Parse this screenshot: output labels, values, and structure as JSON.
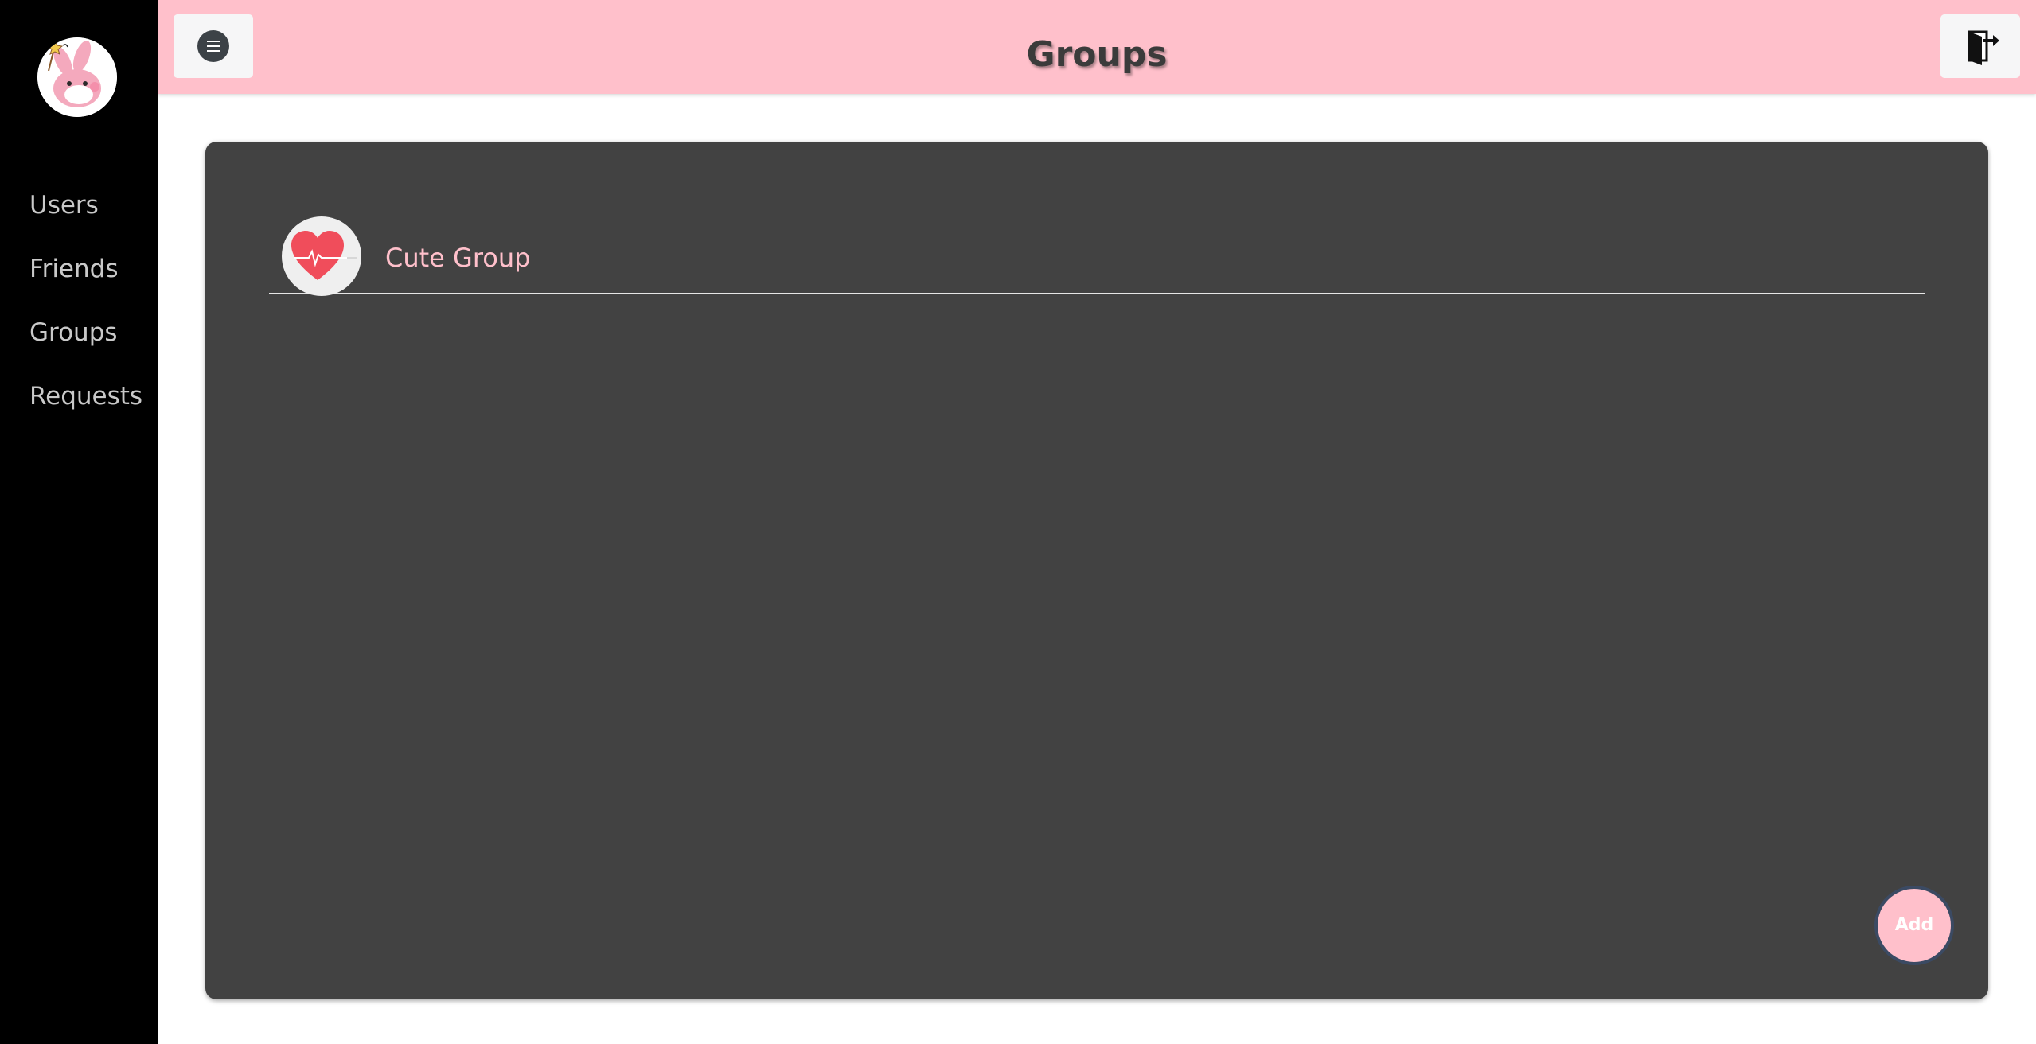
{
  "app": {
    "logo_icon": "bunny-avatar-icon"
  },
  "sidebar": {
    "items": [
      {
        "label": "Users"
      },
      {
        "label": "Friends"
      },
      {
        "label": "Groups"
      },
      {
        "label": "Requests"
      }
    ]
  },
  "header": {
    "title": "Groups",
    "menu_icon": "hamburger-menu-icon",
    "logout_icon": "logout-door-icon"
  },
  "groups": [
    {
      "name": "Cute Group",
      "icon": "heart-pulse-icon"
    }
  ],
  "actions": {
    "add_label": "Add"
  },
  "colors": {
    "sidebar_bg": "#000000",
    "header_bg": "#ffc0cb",
    "panel_bg": "#424242",
    "accent": "#ffc0cb",
    "add_button_border": "#3b4a63"
  }
}
